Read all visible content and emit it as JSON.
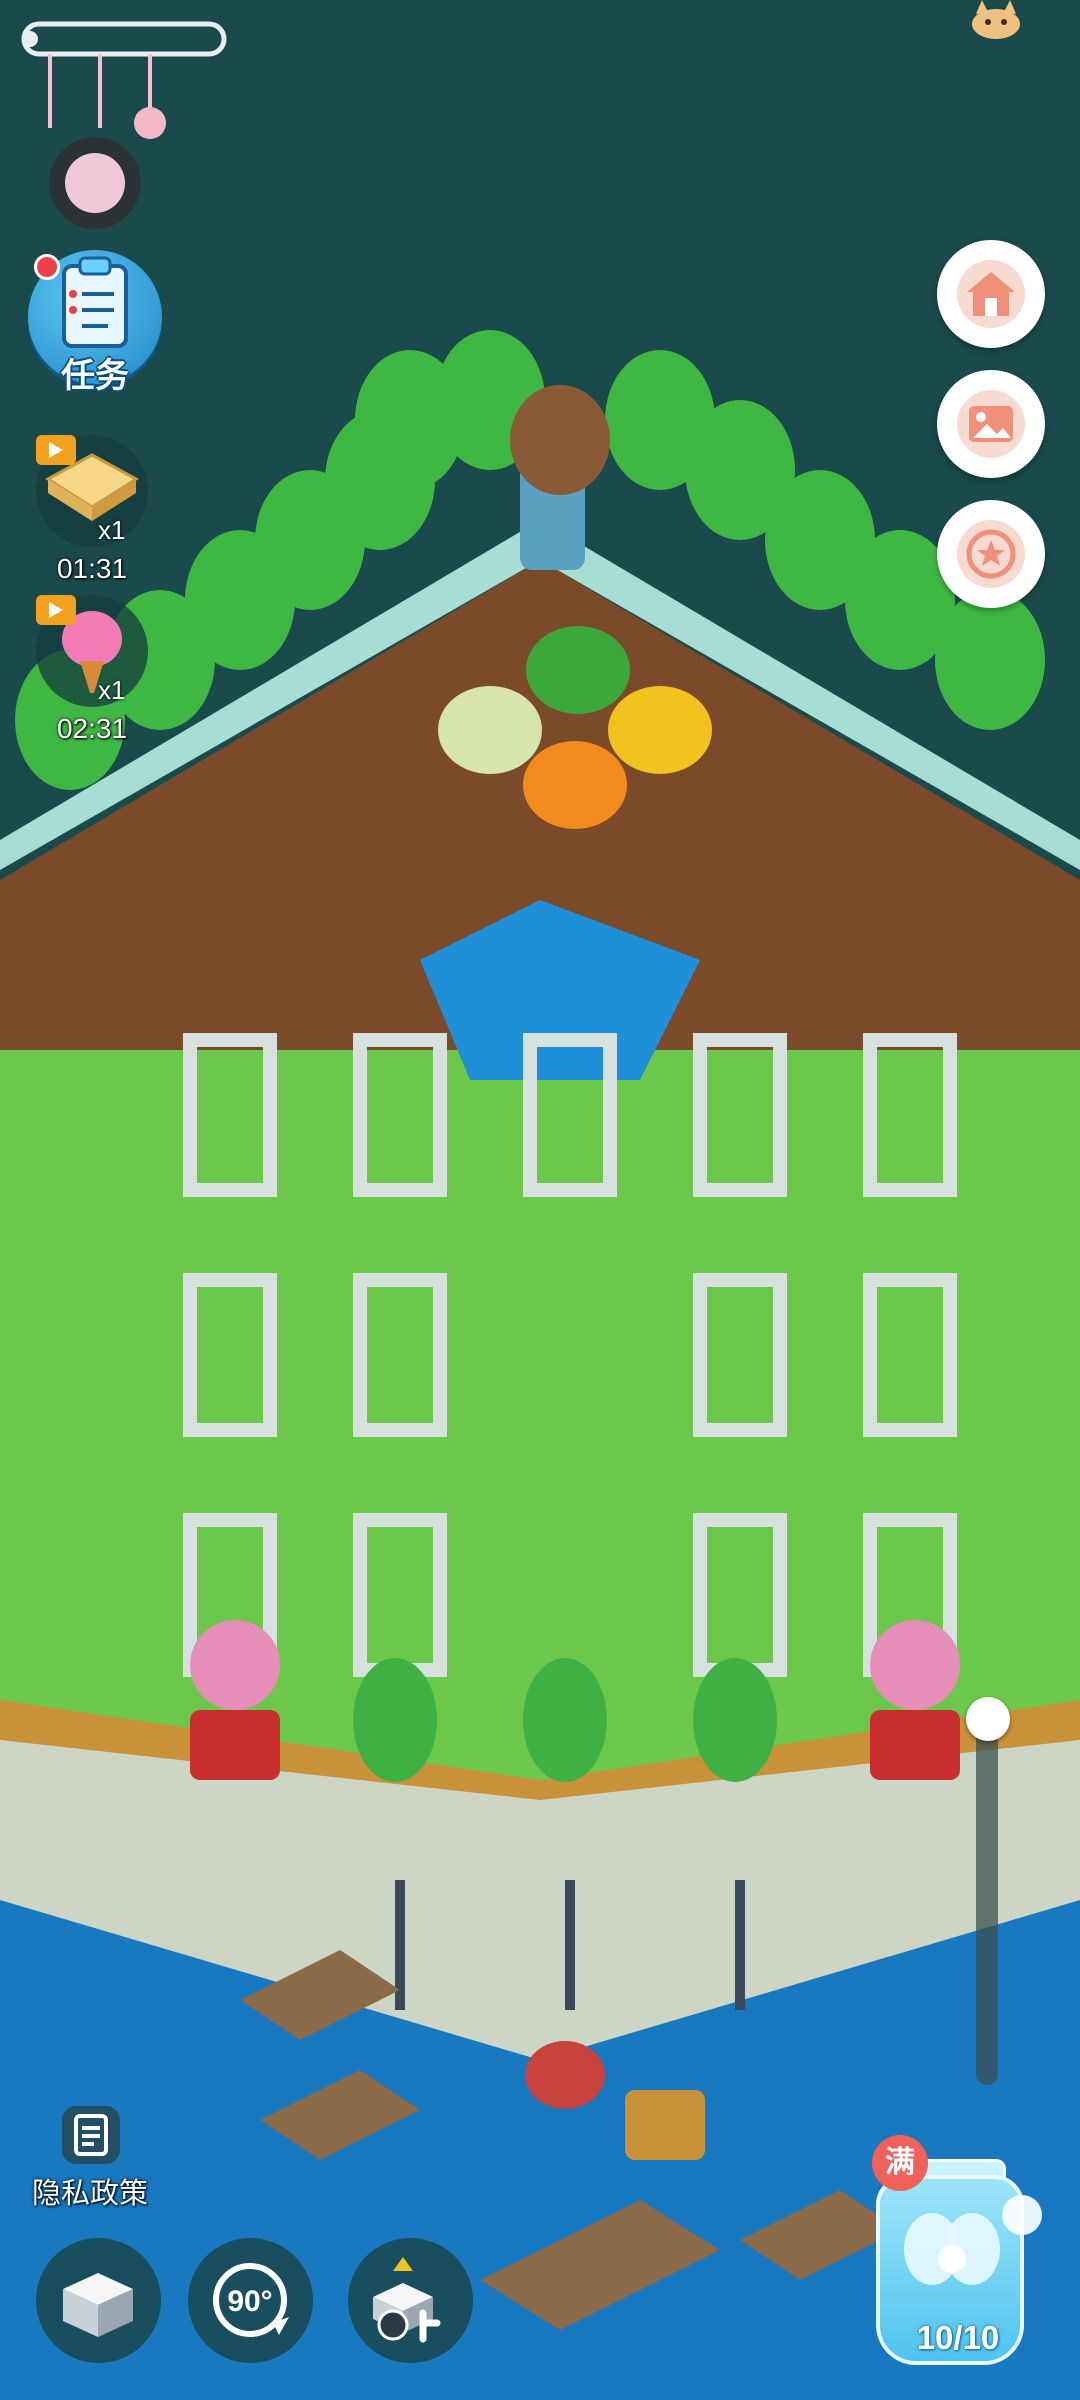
{
  "game": {
    "scene": "isometric-garden-island",
    "colors": {
      "sky": "#1b4a4c",
      "grass": "#6cc84a",
      "water": "#1f8fd8",
      "accent": "#f2605a"
    }
  },
  "task_button": {
    "label": "任务",
    "icon": "clipboard-icon",
    "has_notification": true
  },
  "rewards": [
    {
      "icon": "waffle-cracker-icon",
      "count": "x1",
      "timer": "01:31"
    },
    {
      "icon": "cotton-candy-icon",
      "count": "x1",
      "timer": "02:31"
    }
  ],
  "right_buttons": [
    {
      "icon": "home-icon"
    },
    {
      "icon": "photo-icon"
    },
    {
      "icon": "star-refresh-icon"
    }
  ],
  "zoom_slider": {
    "level": 1.0
  },
  "privacy": {
    "label": "隐私政策",
    "icon": "document-icon"
  },
  "bottom_buttons": [
    {
      "icon": "box-icon"
    },
    {
      "icon": "rotate-icon",
      "label": "90°"
    },
    {
      "icon": "timer-move-icon"
    }
  ],
  "jar": {
    "badge": "满",
    "count": "10/10",
    "icon": "fairy-icon"
  }
}
